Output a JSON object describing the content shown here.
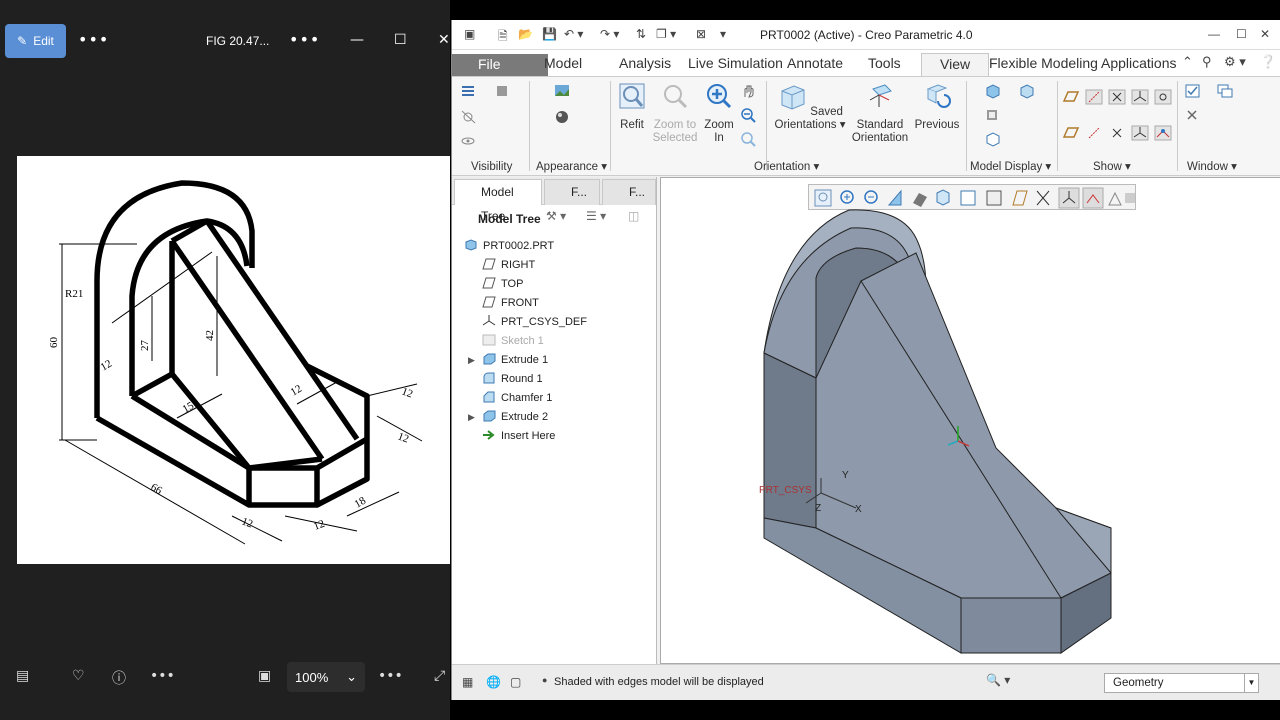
{
  "photos": {
    "edit_label": "Edit",
    "file_title": "FIG 20.47...",
    "zoom": "100%",
    "drawing": {
      "radius_label": "R21",
      "dims": {
        "d60": "60",
        "d12a": "12",
        "d27": "27",
        "d42": "42",
        "d15": "15",
        "d12b": "12",
        "d12c": "12",
        "d12d": "12",
        "d66": "66",
        "d12e": "12",
        "d12f": "12",
        "d18": "18"
      }
    }
  },
  "creo": {
    "title": "PRT0002 (Active) - Creo Parametric 4.0",
    "tabs": [
      {
        "label": "File"
      },
      {
        "label": "Model"
      },
      {
        "label": "Analysis"
      },
      {
        "label": "Live Simulation"
      },
      {
        "label": "Annotate"
      },
      {
        "label": "Tools"
      },
      {
        "label": "View"
      },
      {
        "label": "Flexible Modeling"
      },
      {
        "label": "Applications"
      }
    ],
    "ribbon": {
      "groups": {
        "visibility": "Visibility",
        "appearance": "Appearance ▾",
        "orientation": "Orientation ▾",
        "model_display": "Model Display ▾",
        "show": "Show ▾",
        "window": "Window ▾"
      },
      "refit": "Refit",
      "zoom_selected": [
        "Zoom to",
        "Selected"
      ],
      "zoom_in": [
        "Zoom",
        "In"
      ],
      "saved_orient": [
        "Saved",
        "Orientations ▾"
      ],
      "standard_orient": [
        "Standard",
        "Orientation"
      ],
      "previous": "Previous"
    },
    "tree": {
      "tab1": "Model Tree",
      "tab2": "F...",
      "tab3": "F...",
      "header": "Model Tree",
      "items": [
        {
          "label": "PRT0002.PRT"
        },
        {
          "label": "RIGHT"
        },
        {
          "label": "TOP"
        },
        {
          "label": "FRONT"
        },
        {
          "label": "PRT_CSYS_DEF"
        },
        {
          "label": "Sketch 1"
        },
        {
          "label": "Extrude 1"
        },
        {
          "label": "Round 1"
        },
        {
          "label": "Chamfer 1"
        },
        {
          "label": "Extrude 2"
        },
        {
          "label": "Insert Here"
        }
      ]
    },
    "viewport": {
      "csys_label": "PRT_CSYS",
      "axis_x": "X",
      "axis_y": "Y",
      "axis_z": "Z"
    },
    "status": {
      "message": "Shaded with edges model will be displayed",
      "filter": "Geometry"
    },
    "colors": {
      "accent": "#5a8fd6",
      "model_fill": "#8e9aab",
      "file_tab": "#7a7a7a"
    }
  }
}
